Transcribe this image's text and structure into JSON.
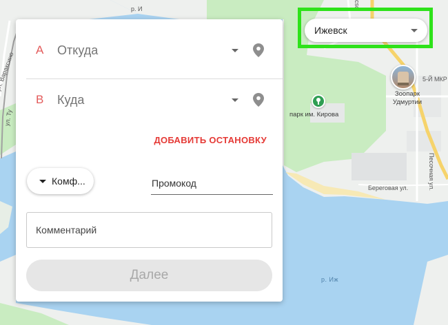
{
  "map": {
    "labels": {
      "river_top": "р. И",
      "street_varaksino": "ул. Вараксино",
      "street_tu": "ул. Ту",
      "street_pesochnaya": "Песочная ул.",
      "street_beregovaya": "Береговая ул.",
      "street_so": "сso",
      "district": "5-Й МКР",
      "park": "парк им. Кирова",
      "zoo": "Зоопарк Удмуртии",
      "river_bottom": "р. Иж"
    },
    "icons": {
      "park": "tree-icon",
      "zoo": "zoo-photo-icon"
    }
  },
  "city_select": {
    "value": "Ижевск",
    "icon": "chevron-down-icon"
  },
  "route": {
    "from": {
      "letter": "A",
      "placeholder": "Откуда"
    },
    "to": {
      "letter": "B",
      "placeholder": "Куда"
    },
    "icons": {
      "dropdown": "chevron-down-icon",
      "location": "location-pin-icon"
    }
  },
  "add_stop_label": "ДОБАВИТЬ ОСТАНОВКУ",
  "tariff": {
    "label": "Комф..."
  },
  "promo": {
    "placeholder": "Промокод"
  },
  "comment": {
    "placeholder": "Комментарий"
  },
  "next_button": {
    "label": "Далее"
  },
  "colors": {
    "accent_red": "#e53935",
    "highlight_green": "#2ee21a",
    "water": "#a9d3f1",
    "land": "#eef0ee",
    "park": "#c9ecc1"
  }
}
